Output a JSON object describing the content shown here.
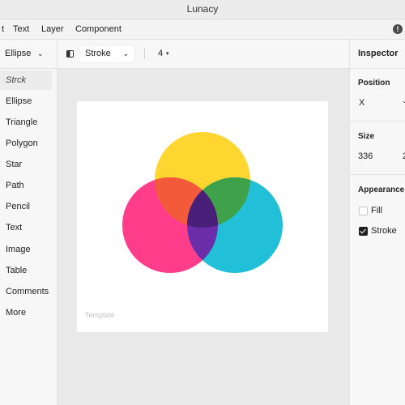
{
  "window": {
    "title": "Lunacy"
  },
  "menu": {
    "items": [
      "t",
      "Text",
      "Layer",
      "Component"
    ]
  },
  "toolbar": {
    "shape_label": "Ellipse",
    "style_label": "Stroke",
    "stroke_width": "4"
  },
  "sidebar": {
    "items": [
      "Strck",
      "Ellipse",
      "Triangle",
      "Polygon",
      "Star",
      "Path",
      "Pencil",
      "Text",
      "Image",
      "Table",
      "Comments",
      "More"
    ]
  },
  "canvas": {
    "artboard_label": "Template",
    "venn_colors": {
      "yellow": "#ffd530",
      "pink": "#ff3d8b",
      "cyan": "#22bfd8"
    }
  },
  "inspector": {
    "title": "Inspector",
    "position_label": "Position",
    "x_label": "X",
    "size_label": "Size",
    "width_value": "336",
    "height_value_partial": "2",
    "appearance_label": "Appearance",
    "fill_label": "Fill",
    "fill_checked": false,
    "stroke_label": "Stroke",
    "stroke_checked": true
  }
}
